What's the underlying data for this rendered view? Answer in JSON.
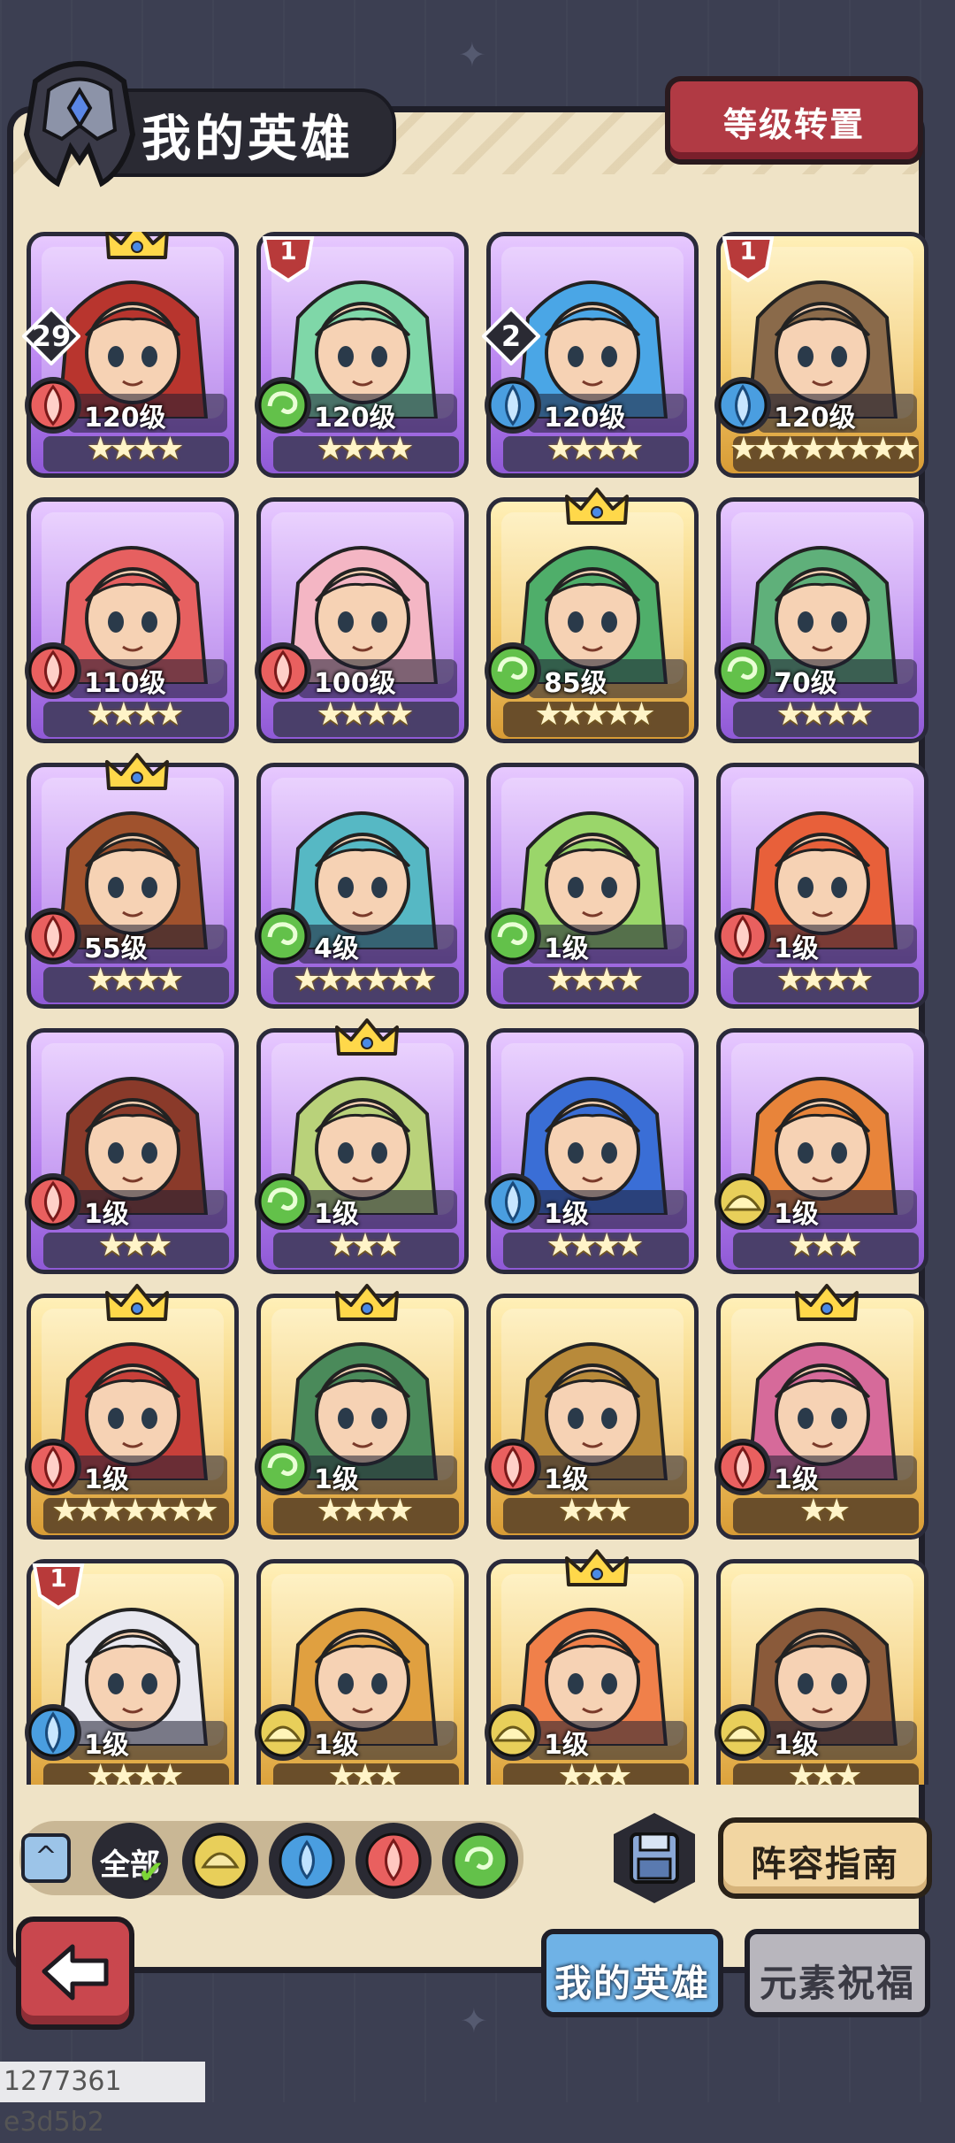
{
  "header": {
    "title": "我的英雄",
    "rank_transfer_label": "等级转置"
  },
  "heroes": [
    {
      "level": "120级",
      "stars": "★★★★",
      "element": "fire",
      "frame": "purple",
      "crown": true,
      "badge_number": "29",
      "rank_badge": null,
      "portrait": "#b8352e"
    },
    {
      "level": "120级",
      "stars": "★★★★",
      "element": "wind",
      "frame": "purple",
      "crown": false,
      "badge_number": null,
      "rank_badge": "1",
      "portrait": "#7fd7a8"
    },
    {
      "level": "120级",
      "stars": "★★★★",
      "element": "water",
      "frame": "purple",
      "crown": false,
      "badge_number": "2",
      "rank_badge": null,
      "portrait": "#4aa6e6"
    },
    {
      "level": "120级",
      "stars": "★★★★★★★★",
      "element": "water",
      "frame": "gold",
      "crown": false,
      "badge_number": null,
      "rank_badge": "1",
      "portrait": "#8a6a4a"
    },
    {
      "level": "110级",
      "stars": "★★★★",
      "element": "fire",
      "frame": "purple",
      "crown": false,
      "badge_number": null,
      "rank_badge": null,
      "portrait": "#e66060"
    },
    {
      "level": "100级",
      "stars": "★★★★",
      "element": "fire",
      "frame": "purple",
      "crown": false,
      "badge_number": null,
      "rank_badge": null,
      "portrait": "#f4b6c4"
    },
    {
      "level": "85级",
      "stars": "★★★★★",
      "element": "wind",
      "frame": "gold",
      "crown": true,
      "badge_number": null,
      "rank_badge": null,
      "portrait": "#4fae6a"
    },
    {
      "level": "70级",
      "stars": "★★★★",
      "element": "wind",
      "frame": "purple",
      "crown": false,
      "badge_number": null,
      "rank_badge": null,
      "portrait": "#5fb07a"
    },
    {
      "level": "55级",
      "stars": "★★★★",
      "element": "fire",
      "frame": "purple",
      "crown": true,
      "badge_number": null,
      "rank_badge": null,
      "portrait": "#a0522d"
    },
    {
      "level": "4级",
      "stars": "★★★★★★",
      "element": "wind",
      "frame": "purple",
      "crown": false,
      "badge_number": null,
      "rank_badge": null,
      "portrait": "#56b8c4"
    },
    {
      "level": "1级",
      "stars": "★★★★",
      "element": "wind",
      "frame": "purple",
      "crown": false,
      "badge_number": null,
      "rank_badge": null,
      "portrait": "#9ad66a"
    },
    {
      "level": "1级",
      "stars": "★★★★",
      "element": "fire",
      "frame": "purple",
      "crown": false,
      "badge_number": null,
      "rank_badge": null,
      "portrait": "#e8603a"
    },
    {
      "level": "1级",
      "stars": "★★★",
      "element": "fire",
      "frame": "purple",
      "crown": false,
      "badge_number": null,
      "rank_badge": null,
      "portrait": "#8a3a2a"
    },
    {
      "level": "1级",
      "stars": "★★★",
      "element": "wind",
      "frame": "purple",
      "crown": true,
      "badge_number": null,
      "rank_badge": null,
      "portrait": "#b9d27a"
    },
    {
      "level": "1级",
      "stars": "★★★★",
      "element": "water",
      "frame": "purple",
      "crown": false,
      "badge_number": null,
      "rank_badge": null,
      "portrait": "#3a6ed6"
    },
    {
      "level": "1级",
      "stars": "★★★",
      "element": "earth",
      "frame": "purple",
      "crown": false,
      "badge_number": null,
      "rank_badge": null,
      "portrait": "#e8843a"
    },
    {
      "level": "1级",
      "stars": "★★★★★★★",
      "element": "fire",
      "frame": "gold",
      "crown": true,
      "badge_number": null,
      "rank_badge": null,
      "portrait": "#c8403a"
    },
    {
      "level": "1级",
      "stars": "★★★★",
      "element": "wind",
      "frame": "gold",
      "crown": true,
      "badge_number": null,
      "rank_badge": null,
      "portrait": "#4a8a5a"
    },
    {
      "level": "1级",
      "stars": "★★★",
      "element": "fire",
      "frame": "gold",
      "crown": false,
      "badge_number": null,
      "rank_badge": null,
      "portrait": "#b88a3a"
    },
    {
      "level": "1级",
      "stars": "★★",
      "element": "fire",
      "frame": "gold",
      "crown": true,
      "badge_number": null,
      "rank_badge": null,
      "portrait": "#d66a9a"
    },
    {
      "level": "1级",
      "stars": "★★★★",
      "element": "water",
      "frame": "gold",
      "crown": false,
      "badge_number": null,
      "rank_badge": "1",
      "portrait": "#e8e8f0"
    },
    {
      "level": "1级",
      "stars": "★★★",
      "element": "earth",
      "frame": "gold",
      "crown": false,
      "badge_number": null,
      "rank_badge": null,
      "portrait": "#e0a040"
    },
    {
      "level": "1级",
      "stars": "★★★",
      "element": "earth",
      "frame": "gold",
      "crown": true,
      "badge_number": null,
      "rank_badge": null,
      "portrait": "#f0804a"
    },
    {
      "level": "1级",
      "stars": "★★★",
      "element": "earth",
      "frame": "gold",
      "crown": false,
      "badge_number": null,
      "rank_badge": null,
      "portrait": "#8a5a3a"
    }
  ],
  "element_colors": {
    "fire": "#e9605f",
    "wind": "#63c14a",
    "water": "#4a9ee0",
    "earth": "#e8cf5a"
  },
  "filter_bar": {
    "all_label": "全部",
    "filters": [
      "earth",
      "water",
      "fire",
      "wind"
    ]
  },
  "guide_label": "阵容指南",
  "tabs": {
    "my_heroes": "我的英雄",
    "element_blessing": "元素祝福"
  },
  "footer_id": "1277361 e3d5b2"
}
